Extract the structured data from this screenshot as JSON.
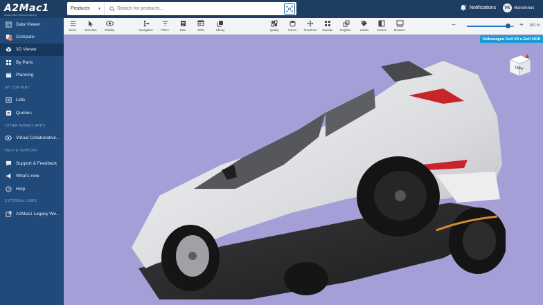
{
  "app": {
    "logo_text": "A2Mac1",
    "logo_tagline": "Automotive Benchmarking"
  },
  "search": {
    "category": "Products",
    "placeholder": "Search for products..."
  },
  "header": {
    "notifications_label": "Notifications",
    "user_initials": "VK",
    "username": "vkoromnos"
  },
  "sidebar": {
    "items": [
      {
        "label": "Data Viewer",
        "icon": "grid-icon"
      },
      {
        "label": "Compare",
        "icon": "compare-icon",
        "badge": "2"
      },
      {
        "label": "3D Viewer",
        "icon": "cube-icon",
        "active": true
      },
      {
        "label": "By Parts",
        "icon": "parts-icon"
      },
      {
        "label": "Planning",
        "icon": "calendar-icon"
      }
    ],
    "section_content": "MY CONTENT",
    "content_items": [
      {
        "label": "Lists",
        "icon": "list-icon"
      },
      {
        "label": "Queries",
        "icon": "query-icon"
      }
    ],
    "section_apps": "OTHER A2MAC1 APPS",
    "app_items": [
      {
        "label": "Virtual Collaborative...",
        "icon": "eye-icon"
      }
    ],
    "section_help": "HELP & SUPPORT",
    "help_items": [
      {
        "label": "Support & Feedback",
        "icon": "chat-icon"
      },
      {
        "label": "What's new",
        "icon": "megaphone-icon"
      },
      {
        "label": "Help",
        "icon": "question-icon"
      }
    ],
    "section_links": "EXTERNAL LINKS",
    "link_items": [
      {
        "label": "A2Mac1 Legacy We...",
        "icon": "external-link-icon"
      }
    ]
  },
  "toolbar": {
    "buttons": [
      {
        "label": "Menu",
        "icon": "menu-icon"
      },
      {
        "label": "Selection",
        "icon": "cursor-icon"
      },
      {
        "label": "Visibility",
        "icon": "eye-icon"
      },
      {
        "label": "Navigation",
        "icon": "navigation-icon"
      },
      {
        "label": "Filters",
        "icon": "filter-icon"
      },
      {
        "label": "Data",
        "icon": "data-icon"
      },
      {
        "label": "BOM",
        "icon": "bom-icon"
      },
      {
        "label": "Library",
        "icon": "library-icon"
      },
      {
        "label": "Quality",
        "icon": "quality-icon"
      },
      {
        "label": "Colors",
        "icon": "colors-icon"
      },
      {
        "label": "Transform",
        "icon": "transform-icon"
      },
      {
        "label": "Explode",
        "icon": "explode-icon"
      },
      {
        "label": "Neighbo...",
        "icon": "neighbours-icon"
      },
      {
        "label": "Labels",
        "icon": "tag-icon"
      },
      {
        "label": "Section",
        "icon": "section-icon"
      },
      {
        "label": "Measure",
        "icon": "measure-icon"
      }
    ],
    "zoom": {
      "minus": "−",
      "plus": "+",
      "value_percent": 182,
      "label": "182 %",
      "slider_fraction": 0.88
    }
  },
  "viewport": {
    "model_name": "Volkswagen Golf VII e-Golf 2018",
    "cube_face": "LEFT",
    "background": "#a59fd8"
  },
  "colors": {
    "topbar": "#1d3d63",
    "sidebar": "#204a7a",
    "sidebar_active": "#17375c",
    "accent": "#1e9ad6"
  }
}
